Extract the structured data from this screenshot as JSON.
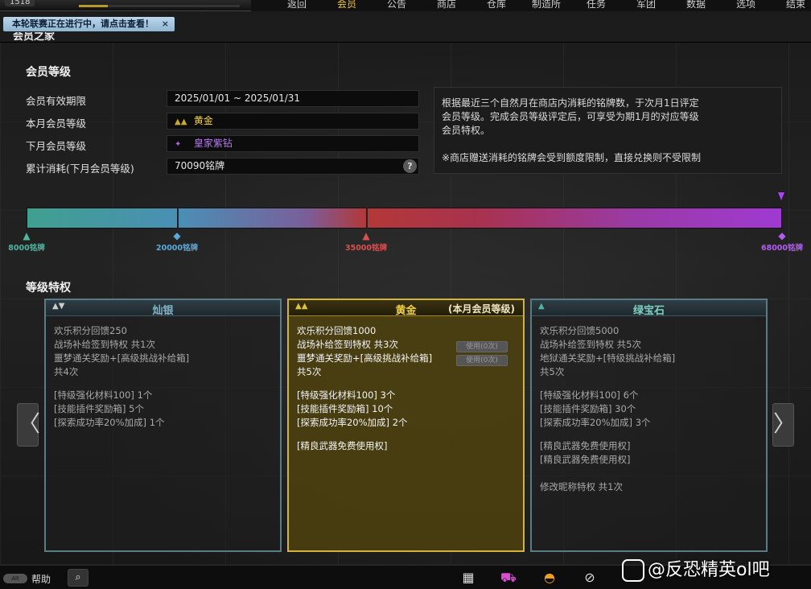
{
  "player": {
    "level": "1518"
  },
  "nav": [
    {
      "label": "返回",
      "name": "nav-back"
    },
    {
      "label": "会员",
      "name": "nav-member"
    },
    {
      "label": "公告",
      "name": "nav-notice"
    },
    {
      "label": "商店",
      "name": "nav-shop"
    },
    {
      "label": "仓库",
      "name": "nav-warehouse"
    },
    {
      "label": "制造所",
      "name": "nav-factory"
    },
    {
      "label": "任务",
      "name": "nav-mission"
    },
    {
      "label": "军团",
      "name": "nav-clan"
    },
    {
      "label": "数据",
      "name": "nav-data"
    },
    {
      "label": "选项",
      "name": "nav-options"
    },
    {
      "label": "结束",
      "name": "nav-exit"
    }
  ],
  "nav_active": "会员",
  "notice": {
    "text": "本轮联赛正在进行中，请点击查看！",
    "close": "×"
  },
  "page": {
    "tab": "会员之家"
  },
  "membership": {
    "title": "会员等级",
    "validity_label": "会员有效期限",
    "validity_value": "2025/01/01 ~ 2025/01/31",
    "this_month_label": "本月会员等级",
    "this_month_value": "黄金",
    "next_month_label": "下月会员等级",
    "next_month_value": "皇家紫钻",
    "consume_label": "累计消耗(下月会员等级)",
    "consume_value": "70090铭牌",
    "help": "?",
    "info_lines": [
      "根据最近三个自然月在商店内消耗的铭牌数，于次月1日评定",
      "会员等级。完成会员等级评定后，可享受为期1月的对应等级",
      "会员特权。",
      "",
      "※商店赠送消耗的铭牌会受到额度限制，直接兑换则不受限制"
    ]
  },
  "progress": {
    "current_value": 70090,
    "max_value": 68000,
    "milestones": [
      {
        "label": "8000铭牌",
        "color": "#4fb5a0",
        "glyph": "▲"
      },
      {
        "label": "20000铭牌",
        "color": "#5aa9d8",
        "glyph": "◆"
      },
      {
        "label": "35000铭牌",
        "color": "#d85050",
        "glyph": "▲"
      },
      {
        "label": "68000铭牌",
        "color": "#b25cf0",
        "glyph": "◆"
      }
    ]
  },
  "privileges": {
    "title": "等级特权",
    "cards": [
      {
        "name": "灿银",
        "badge": "▲▼",
        "lines": [
          "欢乐积分回馈250",
          "战场补给签到特权 共1次",
          "噩梦通关奖励+[高级挑战补给箱]",
          "共4次"
        ],
        "items": [
          "[特级强化材料100] 1个",
          "[技能插件奖励箱] 5个",
          "[探索成功率20%加成] 1个"
        ],
        "extras": []
      },
      {
        "name": "黄金",
        "badge": "▲▲",
        "sub": "(本月会员等级)",
        "lines": [
          "欢乐积分回馈1000",
          "战场补给签到特权 共3次",
          "噩梦通关奖励+[高级挑战补给箱]",
          "共5次"
        ],
        "items": [
          "[特级强化材料100] 3个",
          "[技能插件奖励箱] 10个",
          "[探索成功率20%加成] 2个"
        ],
        "extras": [
          "[精良武器免费使用权]"
        ],
        "use_buttons": [
          "使用(0次)",
          "使用(0次)"
        ]
      },
      {
        "name": "绿宝石",
        "badge": "▲",
        "lines": [
          "欢乐积分回馈5000",
          "战场补给签到特权 共5次",
          "地狱通关奖励+[特级挑战补给箱]",
          "共5次"
        ],
        "items": [
          "[特级强化材料100] 6个",
          "[技能插件奖励箱] 30个",
          "[探索成功率20%加成] 3个"
        ],
        "extras": [
          "[精良武器免费使用权]",
          "[精良武器免费使用权]",
          "",
          "修改昵称特权 共1次"
        ]
      }
    ],
    "prev": "〈",
    "next": "〉"
  },
  "bottom": {
    "key": "Alt",
    "help": "帮助",
    "icons": [
      "calendar-icon",
      "cart-icon",
      "sunset-icon",
      "compass-icon"
    ]
  },
  "watermark": "@反恐精英ol吧"
}
